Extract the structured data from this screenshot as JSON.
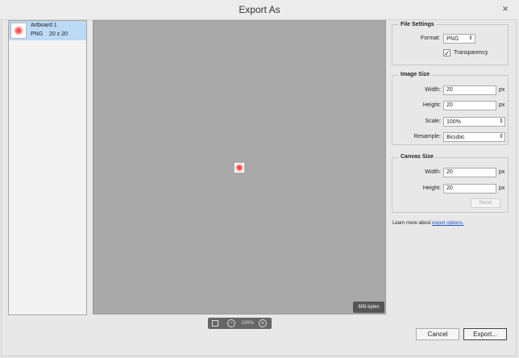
{
  "window": {
    "title": "Export As",
    "close_glyph": "×"
  },
  "assets": [
    {
      "name": "Artboard 1",
      "format": "PNG",
      "size": "20 x 20",
      "selected": true
    }
  ],
  "preview": {
    "file_size": "608 bytes"
  },
  "zoom": {
    "level": "100%",
    "minus": "−",
    "plus": "+"
  },
  "file_settings": {
    "heading": "File Settings",
    "format_label": "Format:",
    "format_value": "PNG",
    "transparency_label": "Transparency",
    "transparency_checked": "✓"
  },
  "image_size": {
    "heading": "Image Size",
    "width_label": "Width:",
    "width_value": "20",
    "width_unit": "px",
    "height_label": "Height:",
    "height_value": "20",
    "height_unit": "px",
    "scale_label": "Scale:",
    "scale_value": "100%",
    "resample_label": "Resample:",
    "resample_value": "Bicubic"
  },
  "canvas_size": {
    "heading": "Canvas Size",
    "width_label": "Width:",
    "width_value": "20",
    "width_unit": "px",
    "height_label": "Height:",
    "height_value": "20",
    "height_unit": "px",
    "reset_label": "Reset"
  },
  "learn_more": {
    "text": "Learn more about ",
    "link_text": "export options."
  },
  "buttons": {
    "cancel": "Cancel",
    "export": "Export..."
  },
  "colors": {
    "selection": "#bcd9f5",
    "preview_bg": "#a9a9a9",
    "link": "#1b55c8"
  }
}
